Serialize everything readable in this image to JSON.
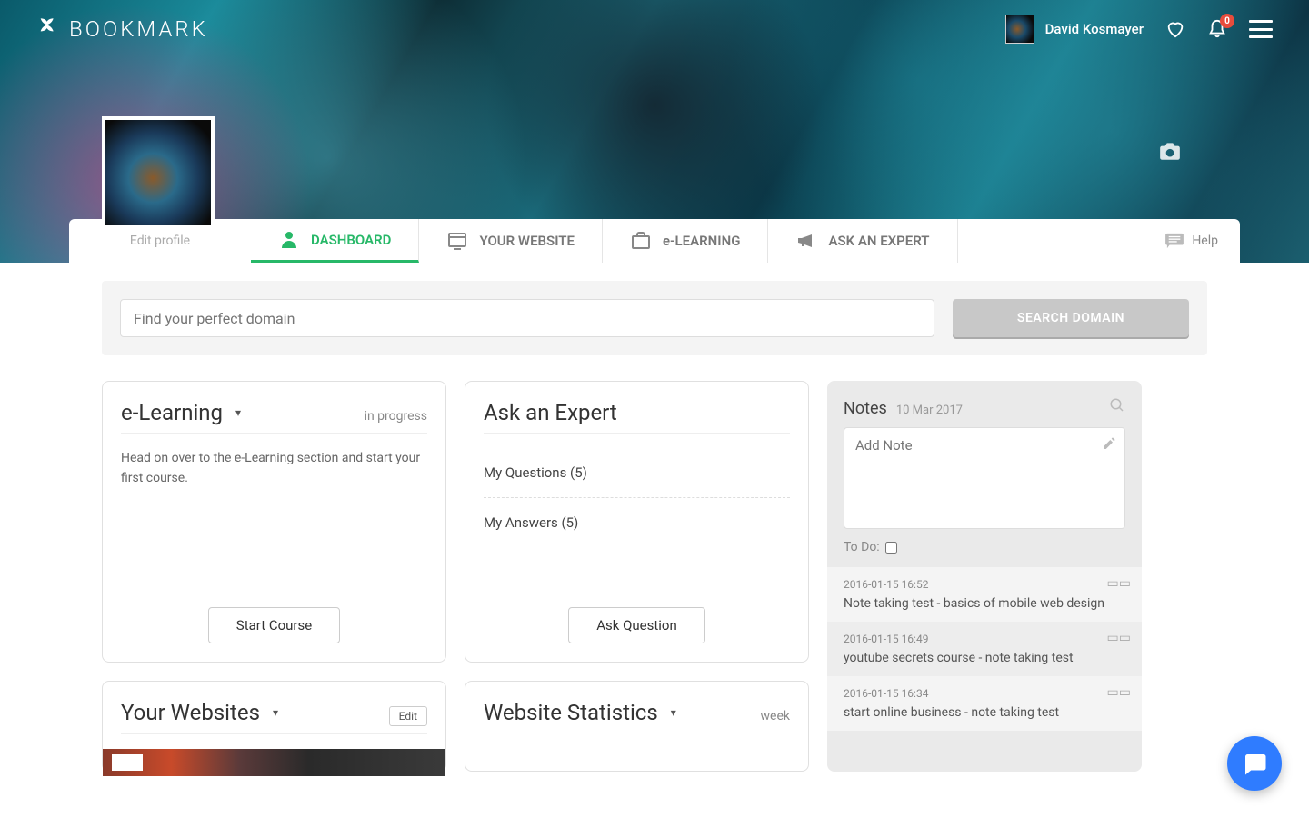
{
  "brand": "BOOKMARK",
  "user": {
    "name": "David Kosmayer"
  },
  "notifications": {
    "count": "0"
  },
  "editProfile": "Edit profile",
  "tabs": {
    "dashboard": "DASHBOARD",
    "yourWebsite": "YOUR WEBSITE",
    "eLearning": "e-LEARNING",
    "askExpert": "ASK AN EXPERT",
    "help": "Help"
  },
  "search": {
    "placeholder": "Find your perfect domain",
    "button": "SEARCH DOMAIN"
  },
  "elearning": {
    "title": "e-Learning",
    "status": "in progress",
    "body": "Head on over to the e-Learning section and start your first course.",
    "button": "Start Course"
  },
  "expert": {
    "title": "Ask an Expert",
    "myQuestions": "My Questions (5)",
    "myAnswers": "My Answers (5)",
    "button": "Ask Question"
  },
  "yourWebsites": {
    "title": "Your Websites",
    "edit": "Edit"
  },
  "stats": {
    "title": "Website Statistics",
    "period": "week"
  },
  "notes": {
    "title": "Notes",
    "date": "10 Mar 2017",
    "addPlaceholder": "Add Note",
    "todo": "To Do:",
    "items": [
      {
        "ts": "2016-01-15 16:52",
        "text": "Note taking test - basics of mobile web design"
      },
      {
        "ts": "2016-01-15 16:49",
        "text": "youtube secrets course - note taking test"
      },
      {
        "ts": "2016-01-15 16:34",
        "text": "start online business - note taking test"
      }
    ]
  }
}
